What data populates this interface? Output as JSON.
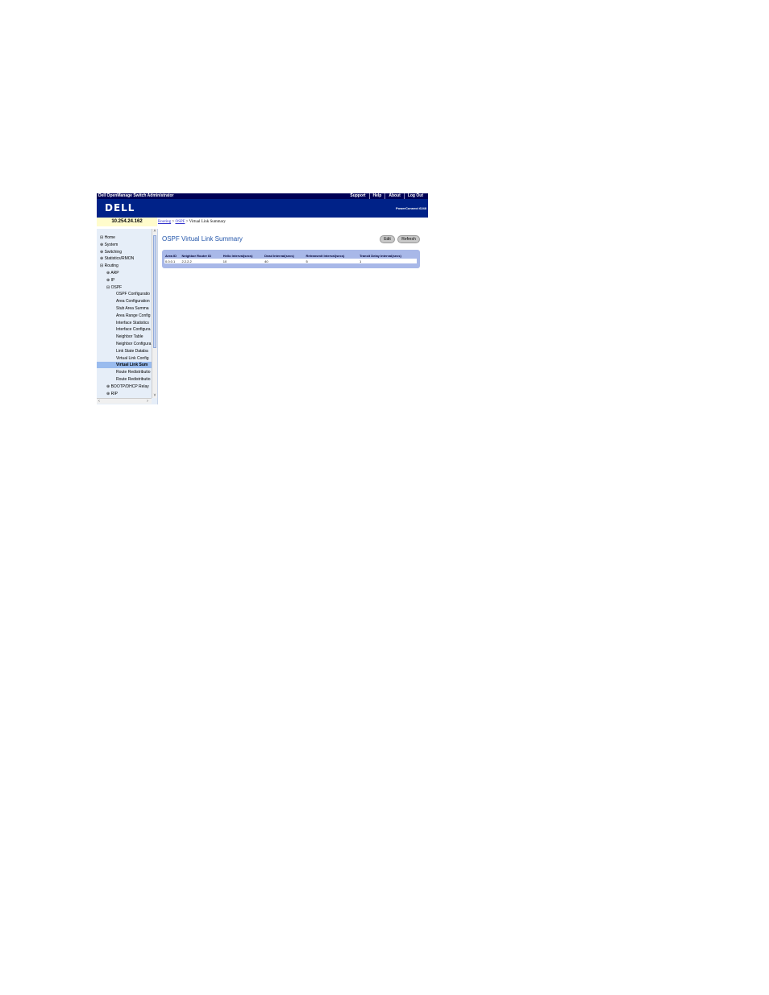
{
  "topbar": {
    "app_title": "Dell OpenManage Switch Administrator",
    "links": [
      "Support",
      "Help",
      "About",
      "Log Out"
    ]
  },
  "banner": {
    "logo": "DELL",
    "model": "PowerConnect 6248"
  },
  "ip": "10.254.24.162",
  "breadcrumb": {
    "items": [
      "Routing",
      "OSPF"
    ],
    "current": "Virtual Link Summary",
    "sep": ">"
  },
  "tree": [
    {
      "icon": "minus",
      "label": "Home",
      "selected": false
    },
    {
      "icon": "plus",
      "label": "System",
      "selected": false
    },
    {
      "icon": "plus",
      "label": "Switching",
      "selected": false
    },
    {
      "icon": "plus",
      "label": "Statistics/RMON",
      "selected": false
    },
    {
      "icon": "minus",
      "label": "Routing",
      "selected": false
    },
    {
      "icon": "plus",
      "label": "ARP",
      "selected": false
    },
    {
      "icon": "plus",
      "label": "IP",
      "selected": false
    },
    {
      "icon": "minus",
      "label": "OSPF",
      "selected": false
    },
    {
      "icon": "",
      "label": "OSPF Configuratio",
      "selected": false
    },
    {
      "icon": "",
      "label": "Area Configuration",
      "selected": false
    },
    {
      "icon": "",
      "label": "Stub Area Summa",
      "selected": false
    },
    {
      "icon": "",
      "label": "Area Range Config",
      "selected": false
    },
    {
      "icon": "",
      "label": "Interface Statistics",
      "selected": false
    },
    {
      "icon": "",
      "label": "Interface Configura",
      "selected": false
    },
    {
      "icon": "",
      "label": "Neighbor Table",
      "selected": false
    },
    {
      "icon": "",
      "label": "Neighbor Configura",
      "selected": false
    },
    {
      "icon": "",
      "label": "Link State Databa",
      "selected": false
    },
    {
      "icon": "",
      "label": "Virtual Link Config",
      "selected": false
    },
    {
      "icon": "",
      "label": "Virtual Link Sum",
      "selected": true
    },
    {
      "icon": "",
      "label": "Route Redistributio",
      "selected": false
    },
    {
      "icon": "",
      "label": "Route Redistributio",
      "selected": false
    },
    {
      "icon": "plus",
      "label": "BOOTP/DHCP Relay",
      "selected": false
    },
    {
      "icon": "plus",
      "label": "RIP",
      "selected": false
    }
  ],
  "main": {
    "title": "OSPF Virtual Link Summary",
    "buttons": {
      "edit": "Edit",
      "refresh": "Refresh"
    },
    "table": {
      "columns": [
        "Area ID",
        "Neighbor Router ID",
        "Hello Interval(secs)",
        "Dead Interval(secs)",
        "Retransmit Interval(secs)",
        "Transit Delay Interval(secs)"
      ],
      "rows": [
        [
          "0.0.0.1",
          "2.2.2.2",
          "10",
          "40",
          "5",
          "1"
        ]
      ]
    }
  }
}
